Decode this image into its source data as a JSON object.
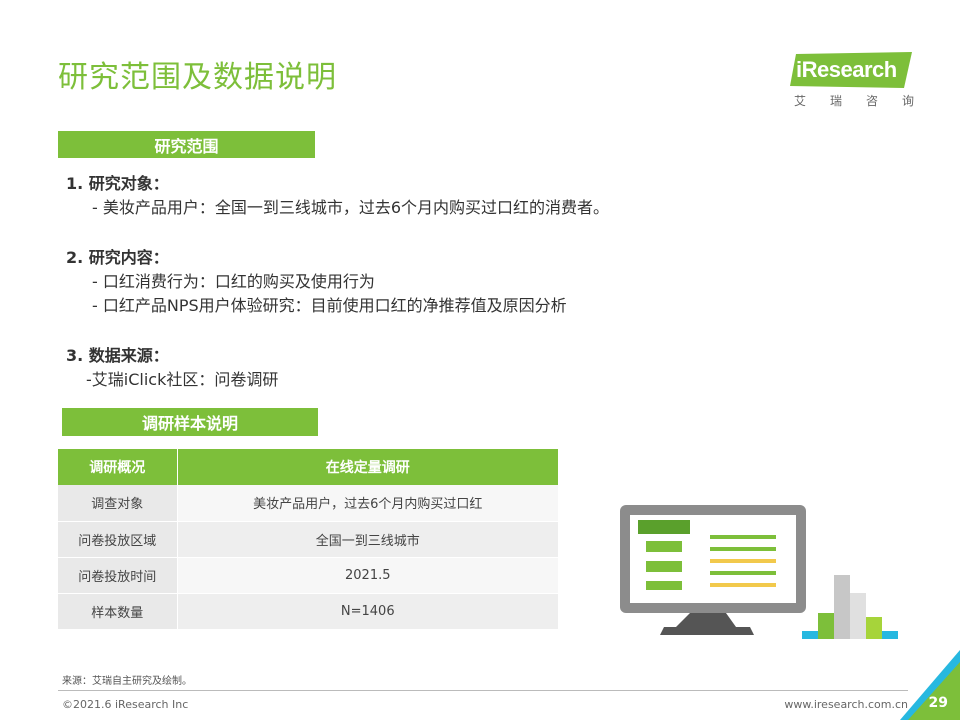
{
  "page": {
    "title": "研究范围及数据说明",
    "number": "29"
  },
  "logo": {
    "text": "iResearch",
    "sub": [
      "艾",
      "瑞",
      "咨",
      "询"
    ]
  },
  "scope": {
    "bar_label": "研究范围",
    "item1_title": "1. 研究对象：",
    "item1_line1": "- 美妆产品用户：全国一到三线城市，过去6个月内购买过口红的消费者。",
    "item2_title": "2.  研究内容：",
    "item2_line1": "- 口红消费行为：口红的购买及使用行为",
    "item2_line2": "- 口红产品NPS用户体验研究：目前使用口红的净推荐值及原因分析",
    "item3_title": "3. 数据来源：",
    "item3_line1": "-艾瑞iClick社区：问卷调研"
  },
  "sample": {
    "bar_label": "调研样本说明",
    "header": [
      "调研概况",
      "在线定量调研"
    ],
    "rows": [
      [
        "调查对象",
        "美妆产品用户，过去6个月内购买过口红"
      ],
      [
        "问卷投放区域",
        "全国一到三线城市"
      ],
      [
        "问卷投放时间",
        "2021.5"
      ],
      [
        "样本数量",
        "N=1406"
      ]
    ]
  },
  "footer": {
    "source": "来源：艾瑞自主研究及绘制。",
    "copyright": "©2021.6 iResearch Inc",
    "website": "www.iresearch.com.cn"
  },
  "colors": {
    "accent": "#7dbf3a",
    "dark_green": "#5aa02c",
    "yellow": "#f2c94c",
    "teal": "#27b8e0",
    "monitor": "#8c8c8c"
  }
}
